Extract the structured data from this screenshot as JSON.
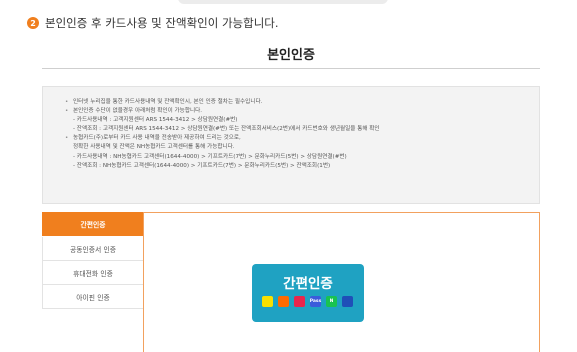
{
  "step": {
    "number": "2",
    "text": "본인인증 후 카드사용 및 잔액확인이 가능합니다."
  },
  "section": {
    "title": "본인인증"
  },
  "notice": {
    "lines": [
      {
        "kind": "bullet",
        "text": "인터넷 누리집을 통한 카드사용내역 및 잔액확인시, 본인 인증 절차는 필수입니다."
      },
      {
        "kind": "bullet",
        "text": "본인인증 수단이 없을경우 아래처럼 확인이 가능합니다."
      },
      {
        "kind": "sub",
        "text": "- 카드사용내역 : 고객지원센터 ARS 1544-3412 > 상담원연결(#번)"
      },
      {
        "kind": "sub",
        "text": "- 잔액조회 : 고객지원센터 ARS 1544-3412 > 상담원연결(#번) 또는 잔액조회서비스(2번)에서 카드번호와 생년월일을 통해 확인"
      },
      {
        "kind": "bullet",
        "text": "농협카드(주)로부터 카드 사용 내역을 전송받아 제공하여 드리는 것으로,"
      },
      {
        "kind": "sub",
        "text": "정확한 사용내역 및 잔액은 NH농협카드 고객센터를 통해 가능합니다."
      },
      {
        "kind": "sub",
        "text": "- 카드사용내역 : NH농협카드 고객센터(1644-4000) > 기프트카드(7번) > 문화누리카드(5번) > 상담원연결(#번)"
      },
      {
        "kind": "sub",
        "text": "- 잔액조회 : NH농협카드 고객센터(1644-4000) > 기프트카드(7번) > 문화누리카드(5번) > 잔액조회(1번)"
      }
    ]
  },
  "tabs": [
    {
      "label": "간편인증",
      "active": true
    },
    {
      "label": "공동인증서 인증",
      "active": false
    },
    {
      "label": "휴대전화 인증",
      "active": false
    },
    {
      "label": "아이핀 인증",
      "active": false
    }
  ],
  "easy_auth": {
    "label": "간편인증",
    "providers": [
      {
        "name": "kakao-icon",
        "label": "",
        "color": "#f9e000",
        "fg": "#3a1d1d"
      },
      {
        "name": "payco-icon",
        "label": "",
        "color": "#ff6b00",
        "fg": "#ffffff"
      },
      {
        "name": "samsung-pass-icon",
        "label": "",
        "color": "#e8264c",
        "fg": "#ffffff"
      },
      {
        "name": "pass-icon",
        "label": "Pass",
        "color": "#3b5bdb",
        "fg": "#ffffff"
      },
      {
        "name": "naver-icon",
        "label": "N",
        "color": "#19c350",
        "fg": "#ffffff"
      },
      {
        "name": "shinhan-icon",
        "label": "",
        "color": "#1f4fb8",
        "fg": "#ffffff"
      }
    ]
  }
}
